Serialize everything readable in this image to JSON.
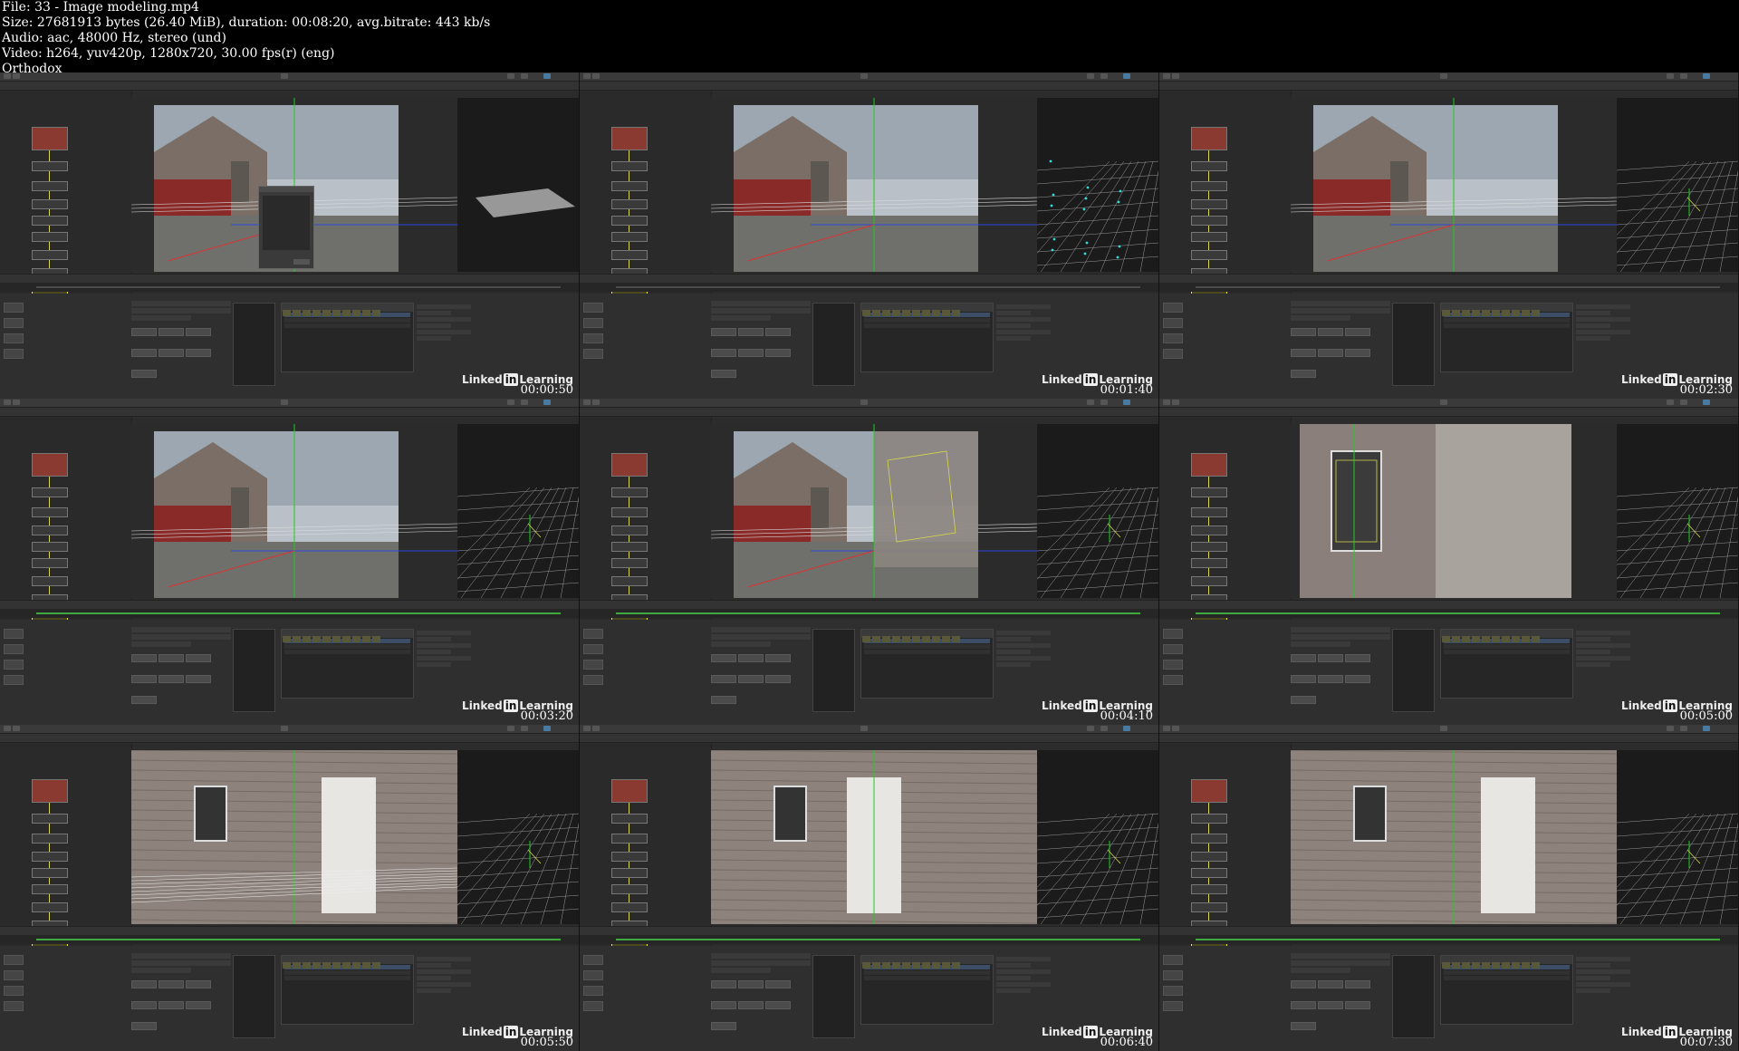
{
  "header": {
    "lines": [
      "File: 33 - Image modeling.mp4",
      "Size: 27681913 bytes (26.40 MiB), duration: 00:08:20, avg.bitrate: 443 kb/s",
      "Audio: aac, 48000 Hz, stereo (und)",
      "Video: h264, yuv420p, 1280x720, 30.00 fps(r) (eng)",
      "Orthodox"
    ]
  },
  "watermark": {
    "brand_left": "Linked",
    "brand_mid": "in",
    "brand_right": "Learning"
  },
  "thumbnails": [
    {
      "timecode": "00:00:50",
      "scene": "barn",
      "persp": "flat",
      "green_timeline": false,
      "dialog": true
    },
    {
      "timecode": "00:01:40",
      "scene": "barn",
      "persp": "points",
      "green_timeline": false,
      "dialog": false
    },
    {
      "timecode": "00:02:30",
      "scene": "barn",
      "persp": "grid",
      "green_timeline": false,
      "dialog": false
    },
    {
      "timecode": "00:03:20",
      "scene": "barn",
      "persp": "grid",
      "green_timeline": true,
      "dialog": false
    },
    {
      "timecode": "00:04:10",
      "scene": "barn-split",
      "persp": "grid",
      "green_timeline": true,
      "dialog": false
    },
    {
      "timecode": "00:05:00",
      "scene": "window",
      "persp": "grid",
      "green_timeline": true,
      "dialog": false
    },
    {
      "timecode": "00:05:50",
      "scene": "siding",
      "persp": "grid",
      "green_timeline": true,
      "dialog": false
    },
    {
      "timecode": "00:06:40",
      "scene": "doors",
      "persp": "grid",
      "green_timeline": true,
      "dialog": false
    },
    {
      "timecode": "00:07:30",
      "scene": "doors2",
      "persp": "grid",
      "green_timeline": true,
      "dialog": false
    }
  ]
}
